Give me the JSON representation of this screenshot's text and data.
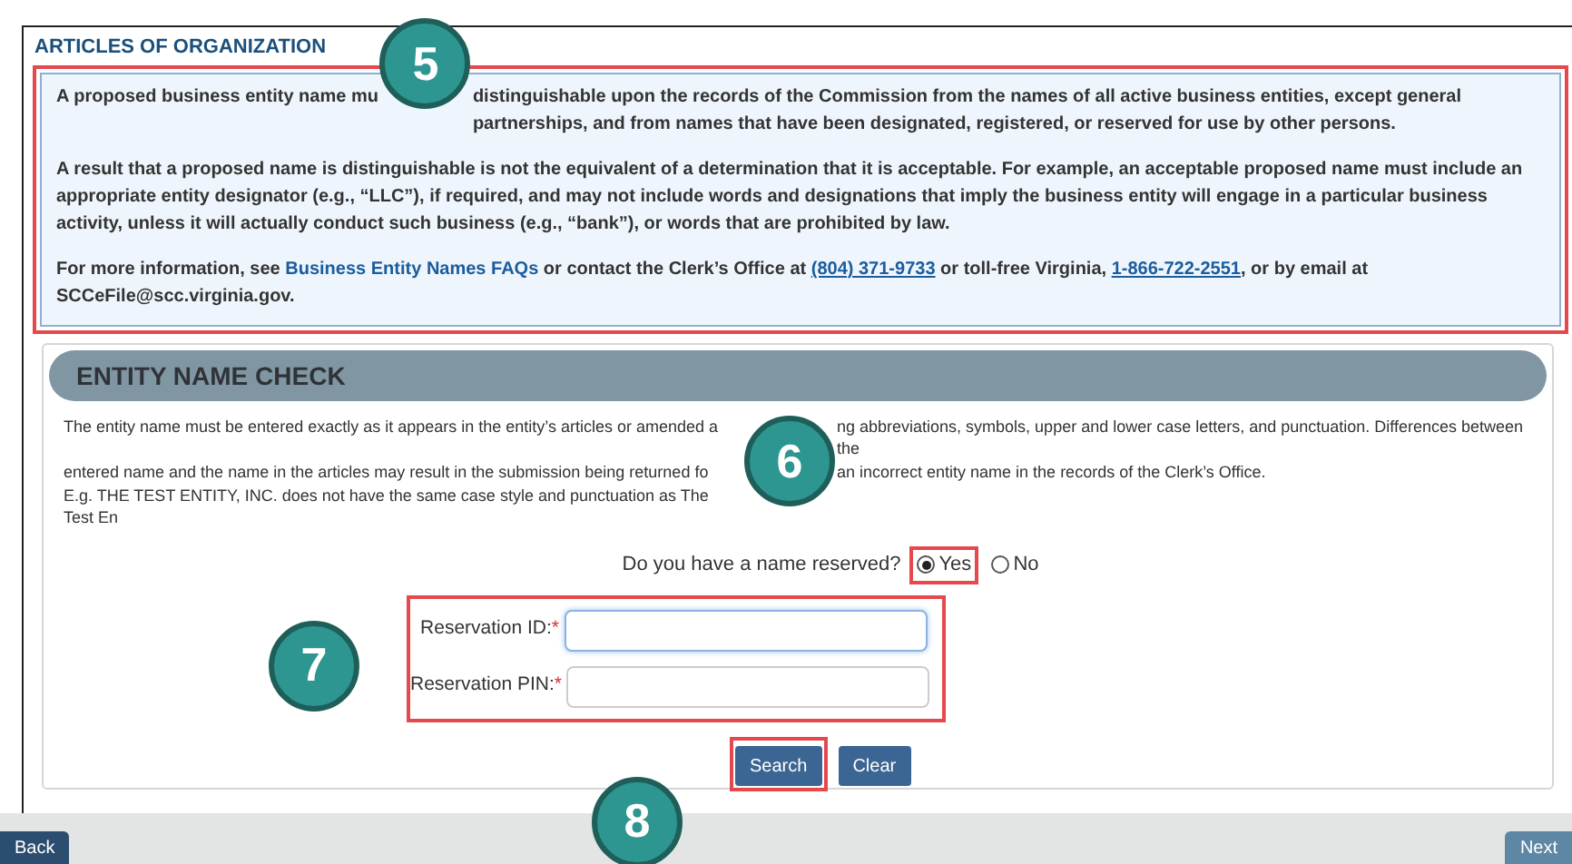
{
  "page_title": "ARTICLES OF ORGANIZATION",
  "notice": {
    "highlighted": true,
    "callout": "5",
    "first_paragraph": {
      "before": "A proposed business entity name mu",
      "after": "distinguishable upon the records of the Commission from the names of all active business entities, except general partnerships, and from names that have been designated, registered, or reserved for use by other persons."
    },
    "second_paragraph": "A result that a proposed name is distinguishable is not the equivalent of a determination that it is acceptable. For example, an acceptable proposed name must include an appropriate entity designator (e.g., “LLC”), if required, and may not include words and designations that imply the business entity will engage in a particular business activity, unless it will actually conduct such business (e.g., “bank”), or words that are prohibited by law.",
    "third_paragraph": [
      {
        "kind": "text",
        "text": "For more information, see "
      },
      {
        "kind": "link",
        "text": "Business Entity Names FAQs"
      },
      {
        "kind": "text",
        "text": " or contact the Clerk’s Office at "
      },
      {
        "kind": "phone",
        "text": "(804) 371-9733"
      },
      {
        "kind": "text",
        "text": " or toll-free Virginia, "
      },
      {
        "kind": "phone",
        "text": "1-866-722-2551"
      },
      {
        "kind": "text",
        "text": ", or by email at SCCeFile@scc.virginia.gov."
      }
    ]
  },
  "section": {
    "title": "ENTITY NAME CHECK",
    "callout": "6",
    "text_rows": [
      {
        "left": "The entity name must be entered exactly as it appears in the entity’s articles or amended a",
        "right": "ng abbreviations, symbols, upper and lower case letters, and punctuation. Differences between the"
      },
      {
        "left": "entered name and the name in the articles may result in the submission being returned fo",
        "right": "an incorrect entity name in the records of the Clerk’s Office."
      },
      {
        "left": "E.g. THE TEST ENTITY, INC. does not have the same case style and punctuation as The Test En"
      }
    ],
    "question": {
      "label": "Do you have a name reserved?",
      "options": [
        {
          "label": "Yes",
          "selected": true,
          "highlighted": true
        },
        {
          "label": "No",
          "selected": false,
          "highlighted": false
        }
      ]
    },
    "fields": {
      "highlighted": true,
      "callout": "7",
      "items": [
        {
          "label": "Reservation ID:",
          "required_mark": "*",
          "focused": true
        },
        {
          "label": "Reservation PIN:",
          "required_mark": "*",
          "focused": false
        }
      ]
    },
    "buttons": [
      {
        "label": "Search",
        "highlighted": true,
        "callout": "8"
      },
      {
        "label": "Clear",
        "highlighted": false
      }
    ]
  },
  "footer": {
    "back": "Back",
    "next": "Next"
  }
}
